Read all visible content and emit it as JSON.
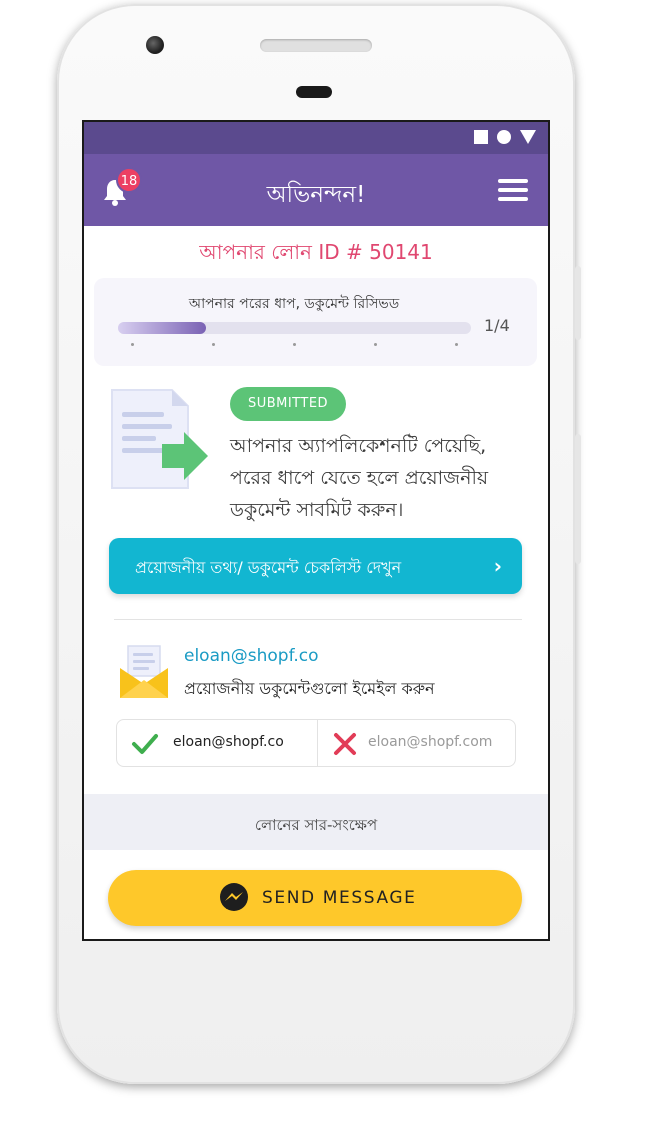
{
  "app_bar": {
    "title": "অভিনন্দন!",
    "notification_count": "18"
  },
  "loan": {
    "id_label": "আপনার লোন ID # 50141"
  },
  "progress": {
    "label": "আপনার পরের ধাপ, ডকুমেন্ট রিসিভড",
    "step": "1/4",
    "fraction": 0.25
  },
  "status": {
    "badge": "SUBMITTED",
    "message": "আপনার অ্যাপলিকেশনটি পেয়েছি, পরের ধাপে যেতে হলে প্রয়োজনীয় ডকুমেন্ট সাবমিট করুন।"
  },
  "checklist_button": {
    "label": "প্রয়োজনীয় তথ্য/ ডকুমেন্ট চেকলিস্ট দেখুন"
  },
  "email": {
    "address": "eloan@shopf.co",
    "note": "প্রয়োজনীয় ডকুমেন্টগুলো ইমেইল করুন",
    "correct": "eloan@shopf.co",
    "incorrect": "eloan@shopf.com"
  },
  "summary": {
    "title": "লোনের সার-সংক্ষেপ"
  },
  "send_button": {
    "label": "SEND MESSAGE"
  },
  "colors": {
    "status_bar": "#5b4a8e",
    "app_bar": "#6f57a6",
    "loan_id": "#e04770",
    "submitted_badge": "#5cc477",
    "checklist_button": "#12b6d1",
    "email_link": "#1a9bc4",
    "send_button": "#fec82a"
  },
  "icons": {
    "notification": "bell-icon",
    "menu": "hamburger-menu-icon",
    "document": "document-arrow-icon",
    "mail": "envelope-icon",
    "correct": "checkmark-icon",
    "incorrect": "cross-icon",
    "messenger": "messenger-icon",
    "chevron": "chevron-right-icon"
  }
}
